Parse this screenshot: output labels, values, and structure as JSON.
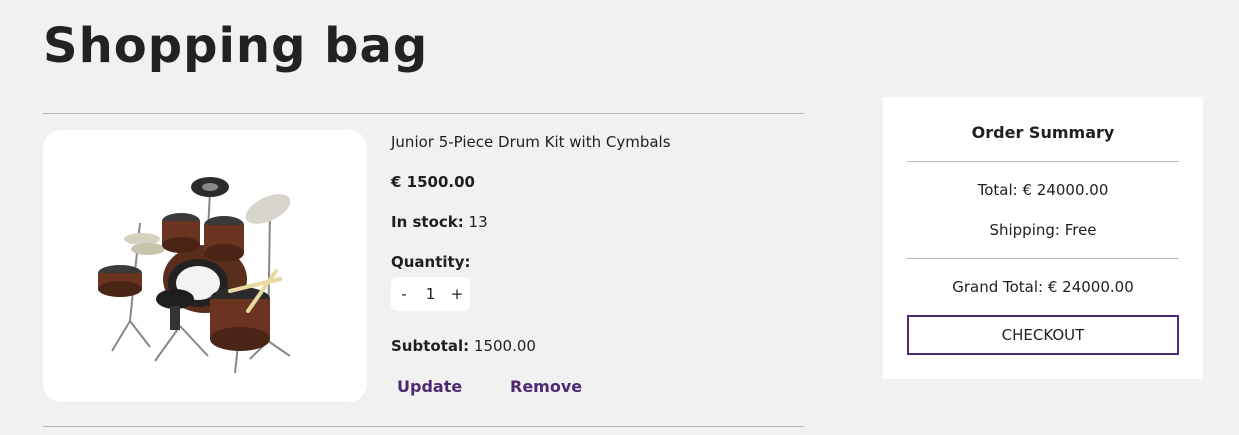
{
  "page": {
    "title": "Shopping bag"
  },
  "item": {
    "name": "Junior 5-Piece Drum Kit with Cymbals",
    "price": "€ 1500.00",
    "stock_label": "In stock:",
    "stock_value": "13",
    "quantity_label": "Quantity:",
    "decrement": "-",
    "quantity": "1",
    "increment": "+",
    "subtotal_label": "Subtotal:",
    "subtotal_value": "1500.00",
    "update_label": "Update",
    "remove_label": "Remove",
    "image_icon": "drum-kit-image"
  },
  "summary": {
    "title": "Order Summary",
    "total": "Total: € 24000.00",
    "shipping": "Shipping: Free",
    "grand_total": "Grand Total: € 24000.00",
    "checkout_label": "CHECKOUT"
  },
  "colors": {
    "background": "#f1f1f1",
    "card": "#ffffff",
    "accent": "#4f2a72",
    "text": "#1f1f1f",
    "divider": "#b9b9b9"
  }
}
